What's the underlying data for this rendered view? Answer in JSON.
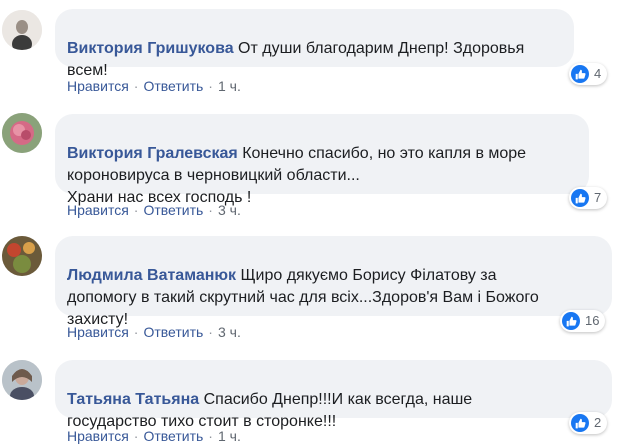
{
  "comments": [
    {
      "author": "Виктория Гришукова",
      "text": "От души благодарим Днепр! Здоровья\nвсем!",
      "like_label": "Нравится",
      "reply_label": "Ответить",
      "time": "1 ч.",
      "reactions": "4",
      "avatar_icon": "avatar-photo-icon"
    },
    {
      "author": "Виктория Гралевская",
      "text": "Конечно спасибо, но это капля в море\nкороновируса в черновицкий области...\nХрани нас всех господь !",
      "like_label": "Нравится",
      "reply_label": "Ответить",
      "time": "3 ч.",
      "reactions": "7",
      "avatar_icon": "avatar-photo-icon"
    },
    {
      "author": "Людмила Ватаманюк",
      "text": "Щиро дякуємо Борису Філатову за\nдопомогу в такий скрутний час для всіх...Здоров'я Вам і Божого\nзахисту!",
      "like_label": "Нравится",
      "reply_label": "Ответить",
      "time": "3 ч.",
      "reactions": "16",
      "avatar_icon": "avatar-photo-icon"
    },
    {
      "author": "Татьяна Татьяна",
      "text": "Спасибо Днепр!!!И как всегда, наше\nгосударство тихо стоит в сторонке!!!",
      "like_label": "Нравится",
      "reply_label": "Ответить",
      "time": "1 ч.",
      "reactions": "2",
      "avatar_icon": "avatar-photo-icon"
    }
  ],
  "separator": "·",
  "colors": {
    "author": "#385898",
    "bubble": "#f0f2f5",
    "like_badge": "#1877f2",
    "meta": "#606770"
  }
}
